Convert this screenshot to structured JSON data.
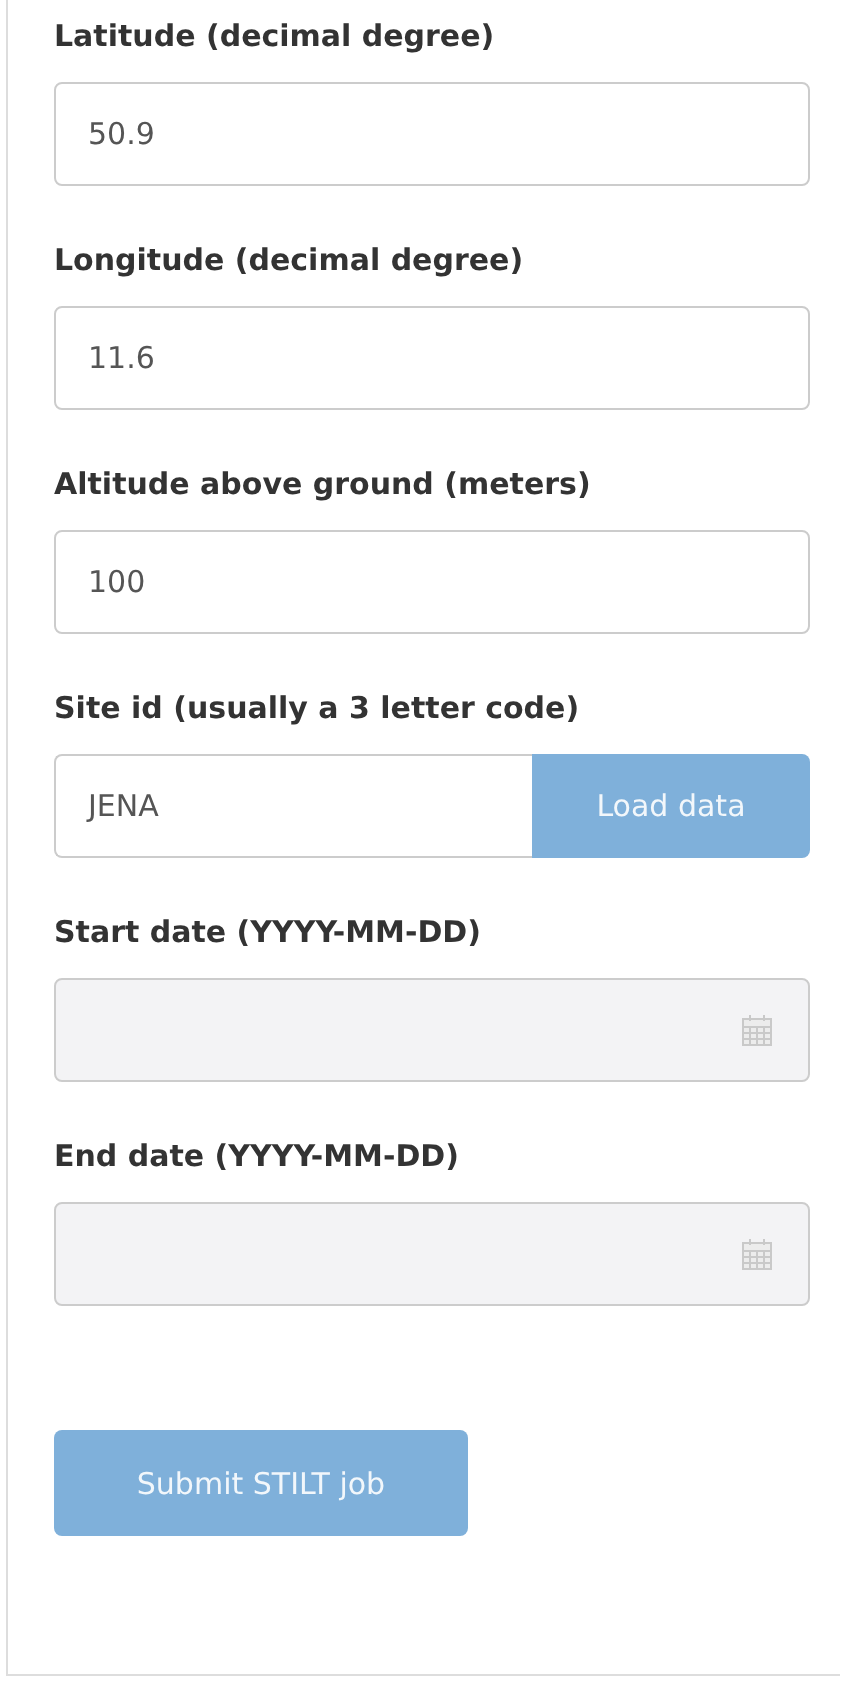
{
  "fields": [
    {
      "kind": "text",
      "label": "Latitude (decimal degree)",
      "value": "50.9",
      "disabled": false
    },
    {
      "kind": "text",
      "label": "Longitude (decimal degree)",
      "value": "11.6",
      "disabled": false
    },
    {
      "kind": "text",
      "label": "Altitude above ground (meters)",
      "value": "100",
      "disabled": false
    },
    {
      "kind": "text_button",
      "label": "Site id (usually a 3 letter code)",
      "value": "JENA",
      "disabled": false,
      "button": {
        "label": "Load data",
        "disabled": true
      }
    },
    {
      "kind": "date",
      "label": "Start date (YYYY-MM-DD)",
      "disabled": true
    },
    {
      "kind": "date",
      "label": "End date (YYYY-MM-DD)",
      "disabled": true
    }
  ],
  "submit_button": {
    "label": "Submit STILT job",
    "disabled": true
  }
}
